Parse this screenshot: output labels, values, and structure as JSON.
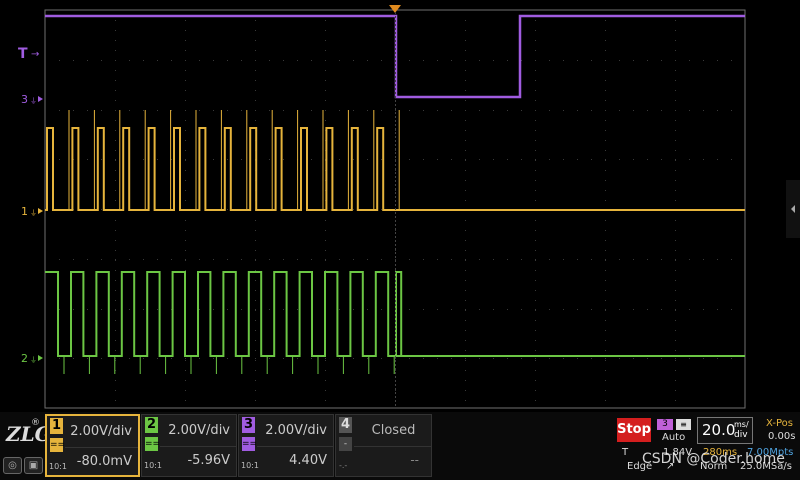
{
  "colors": {
    "ch1": "#e6b43c",
    "ch2": "#6cc644",
    "ch3": "#a05ce0",
    "ch4": "#888888",
    "trigger_marker": "#e08a1e",
    "stop": "#d41e1e",
    "grid_border": "#707070"
  },
  "markers": {
    "trigger": "T",
    "ch3": "3",
    "ch1": "1",
    "ch2": "2"
  },
  "logo": {
    "text": "ZLG",
    "reg": "®"
  },
  "channels": [
    {
      "num": "1",
      "scale": "2.00V/div",
      "offset": "-80.0mV",
      "impedance": "10:1",
      "coupling": "==",
      "selected": true
    },
    {
      "num": "2",
      "scale": "2.00V/div",
      "offset": "-5.96V",
      "impedance": "10:1",
      "coupling": "=="
    },
    {
      "num": "3",
      "scale": "2.00V/div",
      "offset": "4.40V",
      "impedance": "10:1",
      "coupling": "=="
    },
    {
      "num": "4",
      "status": "Closed",
      "offset": "--",
      "impedance": "-.-",
      "coupling": "-"
    }
  ],
  "acquisition": {
    "state": "Stop",
    "trigger_source": "3",
    "trigger_mode": "Auto",
    "trigger_type": "Edge",
    "trigger_level": "1.84V",
    "trigger_label": "T"
  },
  "timebase": {
    "value": "20.0",
    "unit_top": "ms/",
    "unit_bottom": "div",
    "record_length": "280ms",
    "memory_depth": "7.00Mpts",
    "xpos_label": "X-Pos",
    "xpos_value": "0.00s",
    "sample_rate": "25.0MSa/s",
    "norm_label": "Norm"
  },
  "watermark": "CSDN @Coder.home"
}
